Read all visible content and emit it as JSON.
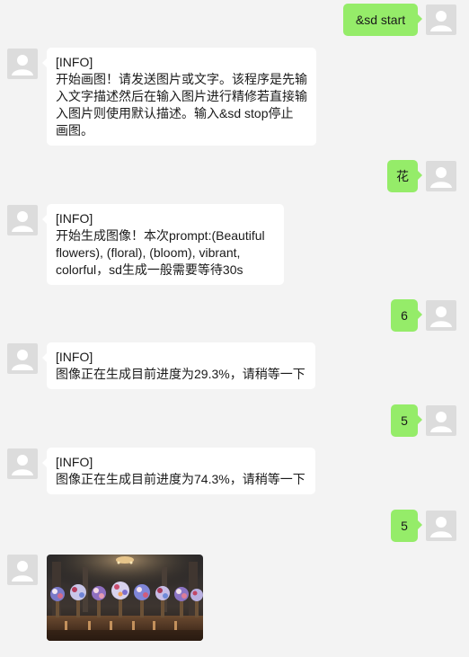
{
  "messages": [
    {
      "type": "out",
      "text": "&sd start"
    },
    {
      "type": "in",
      "tag": "[INFO]",
      "lines": [
        "开始画图！请发送图片或文字。该程序是先输",
        "入文字描述然后在输入图片进行精修若直接输",
        "入图片则使用默认描述。输入&sd stop停止",
        "画图。"
      ]
    },
    {
      "type": "out",
      "text": "花"
    },
    {
      "type": "in",
      "tag": "[INFO]",
      "lines": [
        "开始生成图像！本次prompt:(Beautiful",
        "flowers), (floral), (bloom), vibrant,",
        "colorful，sd生成一般需要等待30s"
      ]
    },
    {
      "type": "out",
      "text": "6"
    },
    {
      "type": "in",
      "tag": "[INFO]",
      "lines": [
        "图像正在生成目前进度为29.3%，请稍等一下"
      ]
    },
    {
      "type": "out",
      "text": "5"
    },
    {
      "type": "in",
      "tag": "[INFO]",
      "lines": [
        "图像正在生成目前进度为74.3%，请稍等一下"
      ]
    },
    {
      "type": "out",
      "text": "5"
    },
    {
      "type": "image",
      "icon": "generated-flower-image"
    }
  ],
  "icons": {
    "avatar": "avatar-icon"
  },
  "colors": {
    "background": "#f3f3f3",
    "outgoing_bubble": "#95ec69",
    "incoming_bubble": "#ffffff",
    "avatar": "#dcdcdc"
  }
}
